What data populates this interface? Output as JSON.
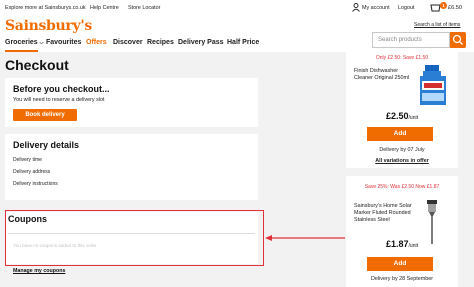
{
  "topbar": {
    "explore": "Explore more at Sainsburys.co.uk",
    "help": "Help Centre",
    "store": "Store Locator",
    "account": "My account",
    "logout": "Logout",
    "basket_count": "1",
    "basket_total": "£6.50"
  },
  "brand": {
    "logo": "Sainsbury's",
    "color": "#f06c00"
  },
  "shopping_list": "Search a list of items",
  "search": {
    "placeholder": "Search products"
  },
  "nav": {
    "groceries": "Groceries",
    "favourites": "Favourites",
    "offers": "Offers",
    "discover": "Discover",
    "recipes": "Recipes",
    "delivery_pass": "Delivery Pass",
    "half_price": "Half Price"
  },
  "page": {
    "title": "Checkout"
  },
  "before": {
    "heading": "Before you checkout...",
    "text": "You will need to reserve a delivery slot",
    "button": "Book delivery"
  },
  "delivery": {
    "heading": "Delivery details",
    "time": "Delivery time",
    "address": "Delivery address",
    "instructions": "Delivery instructions"
  },
  "coupons": {
    "heading": "Coupons",
    "empty": "You have no coupons added to this order",
    "manage": "Manage my coupons"
  },
  "products": [
    {
      "promo": "Only £2.50: Save £1.50",
      "name": "Finish Dishwasher Cleaner Original 250ml",
      "price": "£2.50",
      "unit": "/unit",
      "add": "Add",
      "delivery": "Delivery by 07 July",
      "all_variations": "All variations in offer"
    },
    {
      "promo": "Save 25%: Was £2.50 Now £1.87",
      "name": "Sainsbury's Home Solar Marker Fluted Rounded Stainless Steel",
      "price": "£1.87",
      "unit": "/unit",
      "add": "Add",
      "delivery": "Delivery by 28 September"
    }
  ],
  "colors": {
    "accent": "#f06c00",
    "highlight": "#e03238",
    "background": "#f2f2f2"
  }
}
